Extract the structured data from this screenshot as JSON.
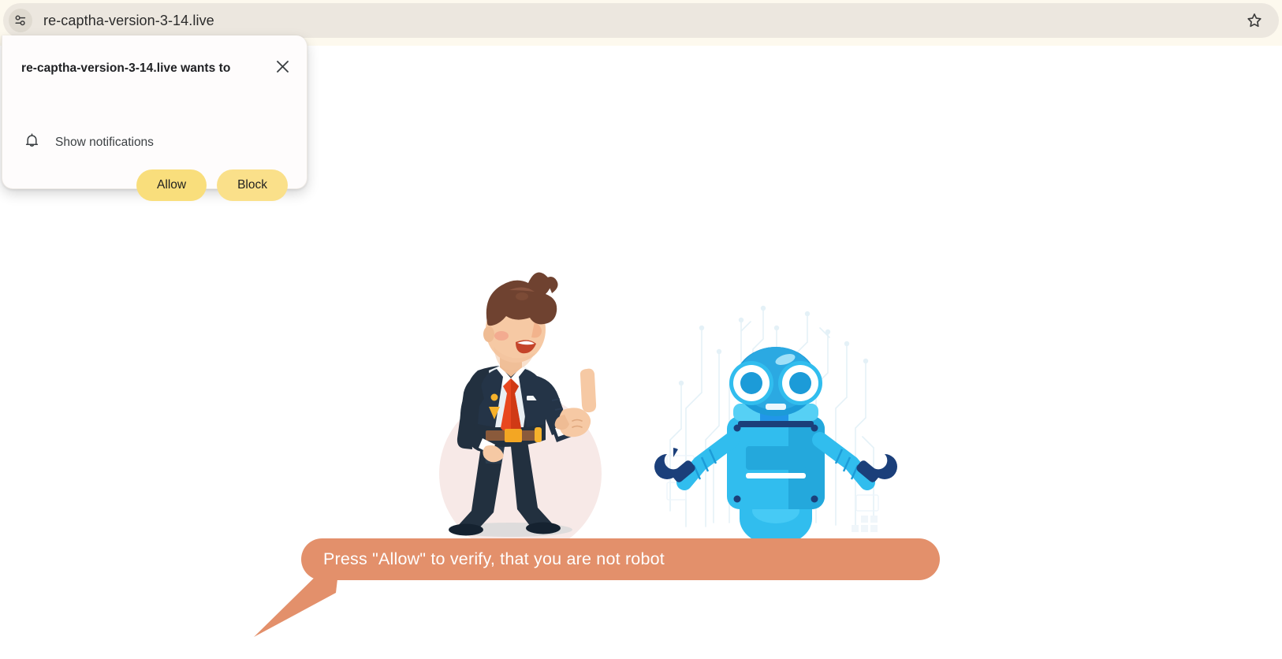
{
  "browser": {
    "omnibox": {
      "url": "re-captha-version-3-14.live",
      "placeholder": "Search Google or type a URL",
      "site_info_icon": "tune-sliders-icon",
      "bookmark_icon": "star-outline-icon"
    }
  },
  "permission_dialog": {
    "title": "re-captha-version-3-14.live wants to",
    "request_icon": "bell-icon",
    "request_label": "Show notifications",
    "close_icon": "close-icon",
    "allow_label": "Allow",
    "block_label": "Block",
    "colors": {
      "allow_button": "#F9DE7C",
      "block_button": "#FAE08A",
      "surface": "#FEFCFC"
    }
  },
  "page": {
    "banner": {
      "text": "Press \"Allow\" to verify, that you are not robot",
      "background_color": "#E3906B",
      "text_color": "#FFFFFF"
    },
    "illustrations": {
      "man": {
        "name": "pointing-businessman-illustration",
        "suit_color": "#243447",
        "tie_color": "#E8471F",
        "skin_color": "#F6C9A4",
        "hair_color": "#6F4230",
        "backdrop_circle_color": "#F7E9E7"
      },
      "robot": {
        "name": "robot-illustration",
        "body_color": "#32BDEE",
        "accent_color": "#1C9BD8",
        "dark_color": "#1B3F7A",
        "circuit_color": "#D8ECF6"
      }
    },
    "background_color": "#FFFFFF"
  }
}
